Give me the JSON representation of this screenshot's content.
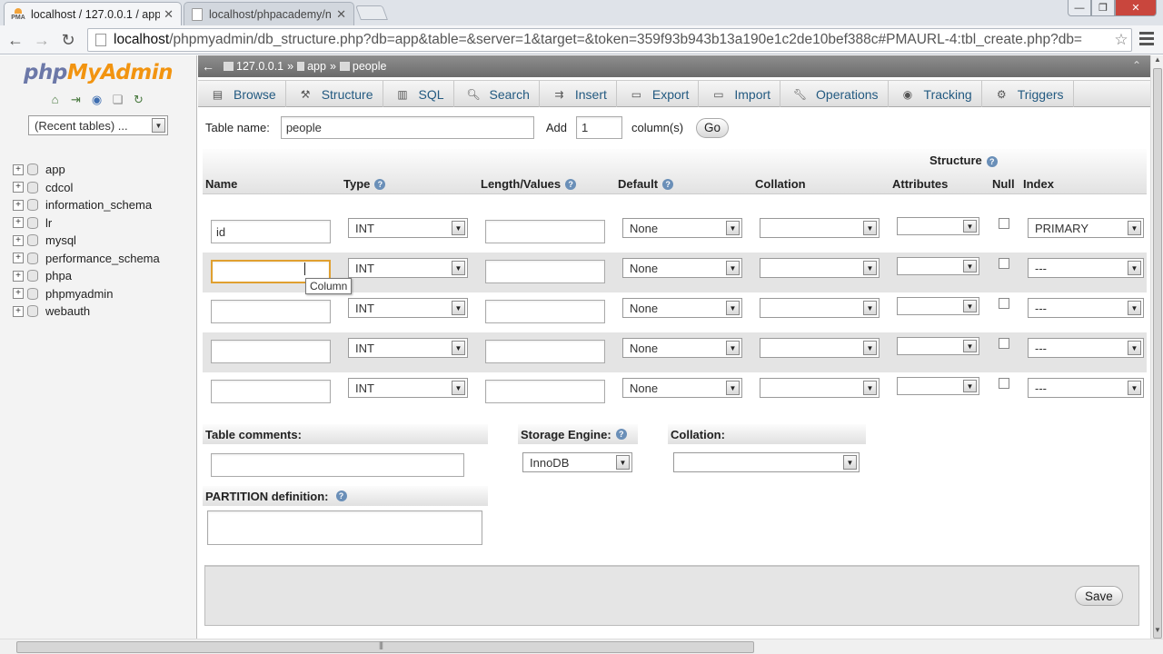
{
  "browser": {
    "tabs": [
      {
        "title": "localhost / 127.0.0.1 / app",
        "active": true
      },
      {
        "title": "localhost/phpacademy/n",
        "active": false
      }
    ],
    "url_host": "localhost",
    "url_rest": "/phpmyadmin/db_structure.php?db=app&table=&server=1&target=&token=359f93b943b13a190e1c2de10bef388c#PMAURL-4:tbl_create.php?db="
  },
  "sidebar": {
    "logo_php": "php",
    "logo_my": "My",
    "logo_admin": "Admin",
    "recent_tables": "(Recent tables) ...",
    "databases": [
      "app",
      "cdcol",
      "information_schema",
      "lr",
      "mysql",
      "performance_schema",
      "phpa",
      "phpmyadmin",
      "webauth"
    ]
  },
  "breadcrumb": {
    "server": "127.0.0.1",
    "database": "app",
    "table": "people"
  },
  "tabs": [
    "Browse",
    "Structure",
    "SQL",
    "Search",
    "Insert",
    "Export",
    "Import",
    "Operations",
    "Tracking",
    "Triggers"
  ],
  "form": {
    "table_name_label": "Table name:",
    "table_name_value": "people",
    "add_label": "Add",
    "add_count": "1",
    "columns_label": "column(s)",
    "go_label": "Go"
  },
  "grid": {
    "structure_label": "Structure",
    "headers": {
      "name": "Name",
      "type": "Type",
      "length": "Length/Values",
      "default": "Default",
      "collation": "Collation",
      "attributes": "Attributes",
      "null": "Null",
      "index": "Index"
    },
    "rows": [
      {
        "name": "id",
        "type": "INT",
        "length": "",
        "default": "None",
        "collation": "",
        "attributes": "",
        "index": "PRIMARY"
      },
      {
        "name": "",
        "type": "INT",
        "length": "",
        "default": "None",
        "collation": "",
        "attributes": "",
        "index": "---"
      },
      {
        "name": "",
        "type": "INT",
        "length": "",
        "default": "None",
        "collation": "",
        "attributes": "",
        "index": "---"
      },
      {
        "name": "",
        "type": "INT",
        "length": "",
        "default": "None",
        "collation": "",
        "attributes": "",
        "index": "---"
      },
      {
        "name": "",
        "type": "INT",
        "length": "",
        "default": "None",
        "collation": "",
        "attributes": "",
        "index": "---"
      }
    ],
    "tooltip": "Column"
  },
  "options": {
    "table_comments_label": "Table comments:",
    "storage_engine_label": "Storage Engine:",
    "storage_engine_value": "InnoDB",
    "collation_label": "Collation:",
    "partition_label": "PARTITION definition:"
  },
  "footer": {
    "save_label": "Save"
  },
  "colors": {
    "tab_link": "#235a81",
    "breadcrumb_bg": "#7c7c7c",
    "logo_orange": "#f29410",
    "logo_blue": "#6c78a8"
  }
}
